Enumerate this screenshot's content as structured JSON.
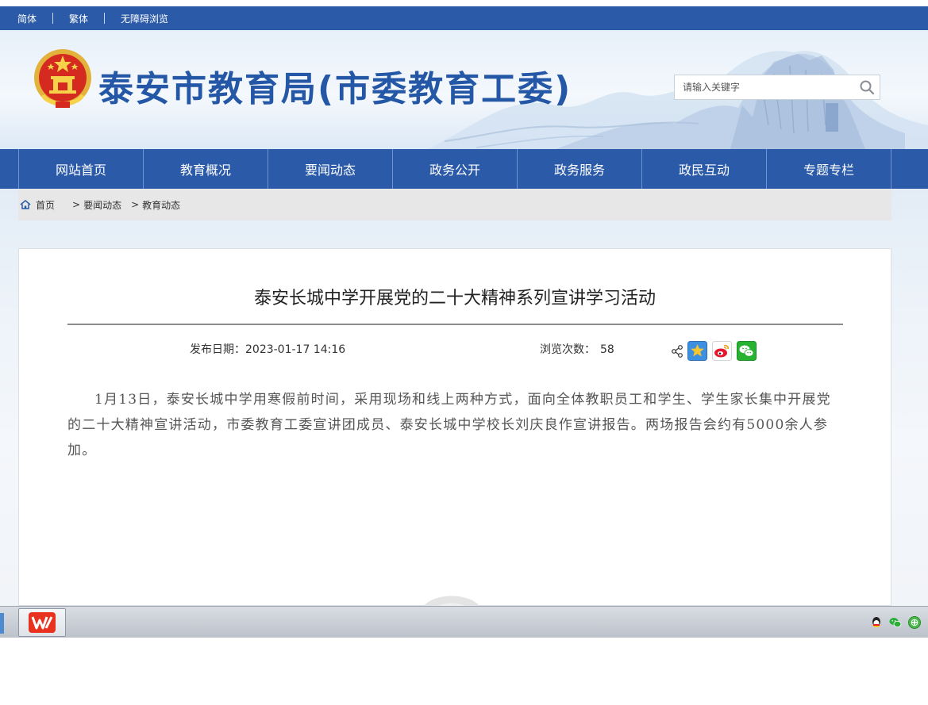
{
  "topbar": {
    "links": [
      "简体",
      "繁体",
      "无障碍浏览"
    ]
  },
  "header": {
    "site_title": "泰安市教育局(市委教育工委)",
    "search_placeholder": "请输入关键字"
  },
  "nav": {
    "items": [
      "网站首页",
      "教育概况",
      "要闻动态",
      "政务公开",
      "政务服务",
      "政民互动",
      "专题专栏"
    ]
  },
  "breadcrumb": {
    "home": "首页",
    "level1": "要闻动态",
    "level2": "教育动态"
  },
  "article": {
    "title": "泰安长城中学开展党的二十大精神系列宣讲学习活动",
    "date_label": "发布日期：",
    "date": "2023-01-17 14:16",
    "views_label": "浏览次数：",
    "views": "58",
    "body": "1月13日，泰安长城中学用寒假前时间，采用现场和线上两种方式，面向全体教职员工和学生、学生家长集中开展党的二十大精神宣讲活动，市委教育工委宣讲团成员、泰安长城中学校长刘庆良作宣讲报告。两场报告会约有5000余人参加。"
  },
  "share": {
    "icons": [
      "share-icon",
      "qzone-icon",
      "weibo-icon",
      "wechat-icon"
    ]
  },
  "taskbar": {
    "app": "wps-icon",
    "tray": [
      "qq-icon",
      "wechat-tray-icon",
      "network-icon"
    ]
  },
  "colors": {
    "brand_blue": "#2a5aa8",
    "title_blue": "#2457a6"
  }
}
